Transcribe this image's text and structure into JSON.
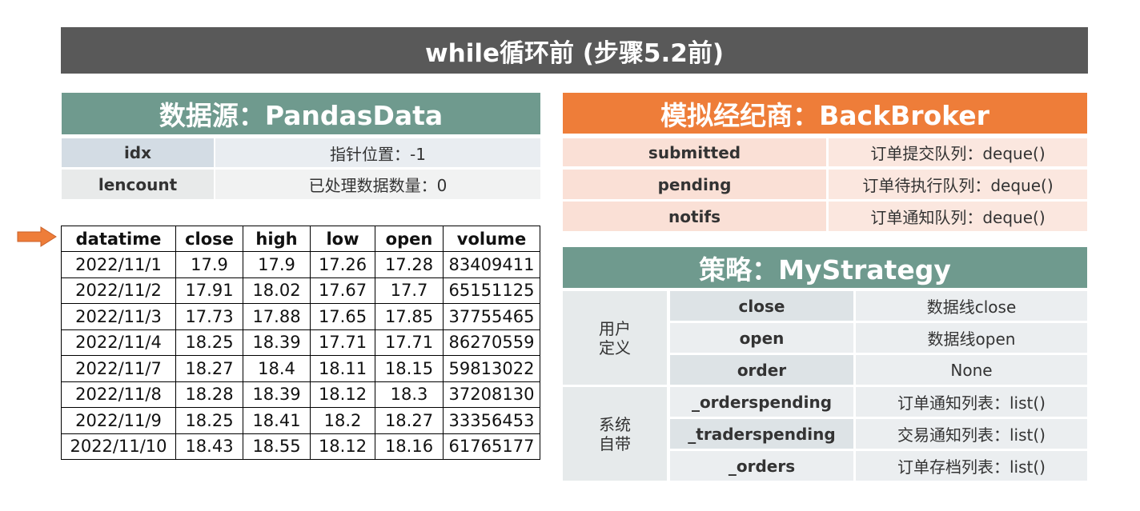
{
  "title": "while循环前 (步骤5.2前)",
  "data_source": {
    "header": "数据源：PandasData",
    "rows": [
      {
        "key": "idx",
        "value": "指针位置：-1"
      },
      {
        "key": "lencount",
        "value": "已处理数据数量：0"
      }
    ],
    "table": {
      "columns": [
        "datatime",
        "close",
        "high",
        "low",
        "open",
        "volume"
      ],
      "rows": [
        [
          "2022/11/1",
          "17.9",
          "17.9",
          "17.26",
          "17.28",
          "83409411"
        ],
        [
          "2022/11/2",
          "17.91",
          "18.02",
          "17.67",
          "17.7",
          "65151125"
        ],
        [
          "2022/11/3",
          "17.73",
          "17.88",
          "17.65",
          "17.85",
          "37755465"
        ],
        [
          "2022/11/4",
          "18.25",
          "18.39",
          "17.71",
          "17.71",
          "86270559"
        ],
        [
          "2022/11/7",
          "18.27",
          "18.4",
          "18.11",
          "18.15",
          "59813022"
        ],
        [
          "2022/11/8",
          "18.28",
          "18.39",
          "18.12",
          "18.3",
          "37208130"
        ],
        [
          "2022/11/9",
          "18.25",
          "18.41",
          "18.2",
          "18.27",
          "33356453"
        ],
        [
          "2022/11/10",
          "18.43",
          "18.55",
          "18.12",
          "18.16",
          "61765177"
        ]
      ]
    }
  },
  "broker": {
    "header": "模拟经纪商：BackBroker",
    "rows": [
      {
        "key": "submitted",
        "value": "订单提交队列：deque()"
      },
      {
        "key": "pending",
        "value": "订单待执行队列：deque()"
      },
      {
        "key": "notifs",
        "value": "订单通知队列：deque()"
      }
    ]
  },
  "strategy": {
    "header": "策略：MyStrategy",
    "groups": [
      {
        "label_line1": "用户",
        "label_line2": "定义",
        "rows": [
          {
            "key": "close",
            "value": "数据线close"
          },
          {
            "key": "open",
            "value": "数据线open"
          },
          {
            "key": "order",
            "value": "None"
          }
        ]
      },
      {
        "label_line1": "系统",
        "label_line2": "自带",
        "rows": [
          {
            "key": "_orderspending",
            "value": "订单通知列表：list()"
          },
          {
            "key": "_traderspending",
            "value": "交易通知列表：list()"
          },
          {
            "key": "_orders",
            "value": "订单存档列表：list()"
          }
        ]
      }
    ]
  },
  "colors": {
    "title_bg": "#595959",
    "teal_header": "#6f9a8e",
    "orange_header": "#ee7d39",
    "arrow": "#ee7d39"
  },
  "icons": {
    "row_pointer": "right-arrow-icon"
  }
}
